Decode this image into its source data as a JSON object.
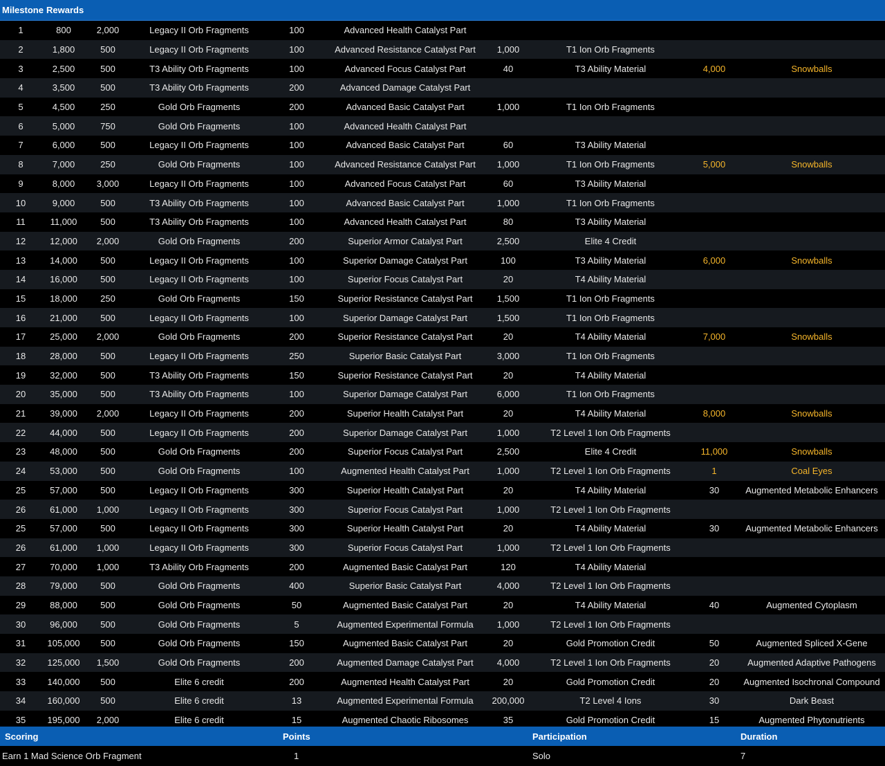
{
  "header": {
    "milestone_label": "Milestone",
    "rewards_label": "Rewards"
  },
  "colors": {
    "header_bg": "#0a5eb3",
    "row_dark": "#000000",
    "row_alt": "#161a1f",
    "highlight": "#f5b52a"
  },
  "rows": [
    {
      "cells": [
        "1",
        "800",
        "2,000",
        "Legacy II Orb Fragments",
        "100",
        "Advanced Health Catalyst Part",
        "",
        "",
        "",
        ""
      ],
      "highlight": false
    },
    {
      "cells": [
        "2",
        "1,800",
        "500",
        "Legacy II Orb Fragments",
        "100",
        "Advanced Resistance Catalyst Part",
        "1,000",
        "T1 Ion Orb Fragments",
        "",
        ""
      ],
      "highlight": false
    },
    {
      "cells": [
        "3",
        "2,500",
        "500",
        "T3 Ability Orb Fragments",
        "100",
        "Advanced Focus Catalyst Part",
        "40",
        "T3 Ability Material",
        "4,000",
        "Snowballs"
      ],
      "highlight": true
    },
    {
      "cells": [
        "4",
        "3,500",
        "500",
        "T3 Ability Orb Fragments",
        "200",
        "Advanced Damage Catalyst Part",
        "",
        "",
        "",
        ""
      ],
      "highlight": false
    },
    {
      "cells": [
        "5",
        "4,500",
        "250",
        "Gold Orb Fragments",
        "200",
        "Advanced Basic Catalyst Part",
        "1,000",
        "T1 Ion Orb Fragments",
        "",
        ""
      ],
      "highlight": false
    },
    {
      "cells": [
        "6",
        "5,000",
        "750",
        "Gold Orb Fragments",
        "100",
        "Advanced Health Catalyst Part",
        "",
        "",
        "",
        ""
      ],
      "highlight": false
    },
    {
      "cells": [
        "7",
        "6,000",
        "500",
        "Legacy II Orb Fragments",
        "100",
        "Advanced Basic Catalyst Part",
        "60",
        "T3 Ability Material",
        "",
        ""
      ],
      "highlight": false
    },
    {
      "cells": [
        "8",
        "7,000",
        "250",
        "Gold Orb Fragments",
        "100",
        "Advanced Resistance Catalyst Part",
        "1,000",
        "T1 Ion Orb Fragments",
        "5,000",
        "Snowballs"
      ],
      "highlight": true
    },
    {
      "cells": [
        "9",
        "8,000",
        "3,000",
        "Legacy II Orb Fragments",
        "100",
        "Advanced Focus Catalyst Part",
        "60",
        "T3 Ability Material",
        "",
        ""
      ],
      "highlight": false
    },
    {
      "cells": [
        "10",
        "9,000",
        "500",
        "T3 Ability Orb Fragments",
        "100",
        "Advanced Basic Catalyst Part",
        "1,000",
        "T1 Ion Orb Fragments",
        "",
        ""
      ],
      "highlight": false
    },
    {
      "cells": [
        "11",
        "11,000",
        "500",
        "T3 Ability Orb Fragments",
        "100",
        "Advanced Health Catalyst Part",
        "80",
        "T3 Ability Material",
        "",
        ""
      ],
      "highlight": false
    },
    {
      "cells": [
        "12",
        "12,000",
        "2,000",
        "Gold Orb Fragments",
        "200",
        "Superior Armor Catalyst Part",
        "2,500",
        "Elite 4 Credit",
        "",
        ""
      ],
      "highlight": false
    },
    {
      "cells": [
        "13",
        "14,000",
        "500",
        "Legacy II Orb Fragments",
        "100",
        "Superior Damage Catalyst Part",
        "100",
        "T3 Ability Material",
        "6,000",
        "Snowballs"
      ],
      "highlight": true
    },
    {
      "cells": [
        "14",
        "16,000",
        "500",
        "Legacy II Orb Fragments",
        "100",
        "Superior Focus Catalyst Part",
        "20",
        "T4 Ability Material",
        "",
        ""
      ],
      "highlight": false
    },
    {
      "cells": [
        "15",
        "18,000",
        "250",
        "Gold Orb Fragments",
        "150",
        "Superior Resistance Catalyst Part",
        "1,500",
        "T1 Ion Orb Fragments",
        "",
        ""
      ],
      "highlight": false
    },
    {
      "cells": [
        "16",
        "21,000",
        "500",
        "Legacy II Orb Fragments",
        "100",
        "Superior Damage Catalyst Part",
        "1,500",
        "T1 Ion Orb Fragments",
        "",
        ""
      ],
      "highlight": false
    },
    {
      "cells": [
        "17",
        "25,000",
        "2,000",
        "Gold Orb Fragments",
        "200",
        "Superior Resistance Catalyst Part",
        "20",
        "T4 Ability Material",
        "7,000",
        "Snowballs"
      ],
      "highlight": true
    },
    {
      "cells": [
        "18",
        "28,000",
        "500",
        "Legacy II Orb Fragments",
        "250",
        "Superior Basic Catalyst Part",
        "3,000",
        "T1 Ion Orb Fragments",
        "",
        ""
      ],
      "highlight": false
    },
    {
      "cells": [
        "19",
        "32,000",
        "500",
        "T3 Ability Orb Fragments",
        "150",
        "Superior Resistance Catalyst Part",
        "20",
        "T4 Ability Material",
        "",
        ""
      ],
      "highlight": false
    },
    {
      "cells": [
        "20",
        "35,000",
        "500",
        "T3 Ability Orb Fragments",
        "100",
        "Superior Damage Catalyst Part",
        "6,000",
        "T1 Ion Orb Fragments",
        "",
        ""
      ],
      "highlight": false
    },
    {
      "cells": [
        "21",
        "39,000",
        "2,000",
        "Legacy II Orb Fragments",
        "200",
        "Superior Health Catalyst Part",
        "20",
        "T4 Ability Material",
        "8,000",
        "Snowballs"
      ],
      "highlight": true
    },
    {
      "cells": [
        "22",
        "44,000",
        "500",
        "Legacy II Orb Fragments",
        "200",
        "Superior Damage Catalyst Part",
        "1,000",
        "T2 Level 1 Ion Orb Fragments",
        "",
        ""
      ],
      "highlight": false
    },
    {
      "cells": [
        "23",
        "48,000",
        "500",
        "Gold Orb Fragments",
        "200",
        "Superior Focus Catalyst Part",
        "2,500",
        "Elite 4 Credit",
        "11,000",
        "Snowballs"
      ],
      "highlight": true
    },
    {
      "cells": [
        "24",
        "53,000",
        "500",
        "Gold Orb Fragments",
        "100",
        "Augmented Health Catalyst Part",
        "1,000",
        "T2 Level 1 Ion Orb Fragments",
        "1",
        "Coal Eyes"
      ],
      "highlight": true
    },
    {
      "cells": [
        "25",
        "57,000",
        "500",
        "Legacy II Orb Fragments",
        "300",
        "Superior Health Catalyst Part",
        "20",
        "T4 Ability Material",
        "30",
        "Augmented Metabolic Enhancers"
      ],
      "highlight": false
    },
    {
      "cells": [
        "26",
        "61,000",
        "1,000",
        "Legacy II Orb Fragments",
        "300",
        "Superior Focus Catalyst Part",
        "1,000",
        "T2 Level 1 Ion Orb Fragments",
        "",
        ""
      ],
      "highlight": false
    },
    {
      "cells": [
        "25",
        "57,000",
        "500",
        "Legacy II Orb Fragments",
        "300",
        "Superior Health Catalyst Part",
        "20",
        "T4 Ability Material",
        "30",
        "Augmented Metabolic Enhancers"
      ],
      "highlight": false
    },
    {
      "cells": [
        "26",
        "61,000",
        "1,000",
        "Legacy II Orb Fragments",
        "300",
        "Superior Focus Catalyst Part",
        "1,000",
        "T2 Level 1 Ion Orb Fragments",
        "",
        ""
      ],
      "highlight": false
    },
    {
      "cells": [
        "27",
        "70,000",
        "1,000",
        "T3 Ability Orb Fragments",
        "200",
        "Augmented Basic Catalyst Part",
        "120",
        "T4 Ability Material",
        "",
        ""
      ],
      "highlight": false
    },
    {
      "cells": [
        "28",
        "79,000",
        "500",
        "Gold Orb Fragments",
        "400",
        "Superior Basic Catalyst Part",
        "4,000",
        "T2 Level 1 Ion Orb Fragments",
        "",
        ""
      ],
      "highlight": false
    },
    {
      "cells": [
        "29",
        "88,000",
        "500",
        "Gold Orb Fragments",
        "50",
        "Augmented Basic Catalyst Part",
        "20",
        "T4 Ability Material",
        "40",
        "Augmented Cytoplasm"
      ],
      "highlight": false
    },
    {
      "cells": [
        "30",
        "96,000",
        "500",
        "Gold Orb Fragments",
        "5",
        "Augmented Experimental Formula",
        "1,000",
        "T2 Level 1 Ion Orb Fragments",
        "",
        ""
      ],
      "highlight": false
    },
    {
      "cells": [
        "31",
        "105,000",
        "500",
        "Gold Orb Fragments",
        "150",
        "Augmented Basic Catalyst Part",
        "20",
        "Gold Promotion Credit",
        "50",
        "Augmented Spliced X-Gene"
      ],
      "highlight": false
    },
    {
      "cells": [
        "32",
        "125,000",
        "1,500",
        "Gold Orb Fragments",
        "200",
        "Augmented Damage Catalyst Part",
        "4,000",
        "T2 Level 1 Ion Orb Fragments",
        "20",
        "Augmented Adaptive Pathogens"
      ],
      "highlight": false
    },
    {
      "cells": [
        "33",
        "140,000",
        "500",
        "Elite 6 credit",
        "200",
        "Augmented Health Catalyst Part",
        "20",
        "Gold Promotion Credit",
        "20",
        "Augmented Isochronal Compound"
      ],
      "highlight": false
    },
    {
      "cells": [
        "34",
        "160,000",
        "500",
        "Elite 6 credit",
        "13",
        "Augmented Experimental Formula",
        "200,000",
        "T2 Level 4 Ions",
        "30",
        "Dark Beast"
      ],
      "highlight": false
    },
    {
      "cells": [
        "35",
        "195,000",
        "2,000",
        "Elite 6 credit",
        "15",
        "Augmented Chaotic Ribosomes",
        "35",
        "Gold Promotion Credit",
        "15",
        "Augmented Phytonutrients"
      ],
      "highlight": false
    }
  ],
  "scoring": {
    "headers": [
      "Scoring",
      "Points",
      "Participation",
      "Duration"
    ],
    "row": [
      "Earn 1 Mad Science Orb Fragment",
      "1",
      "Solo",
      "7"
    ]
  }
}
